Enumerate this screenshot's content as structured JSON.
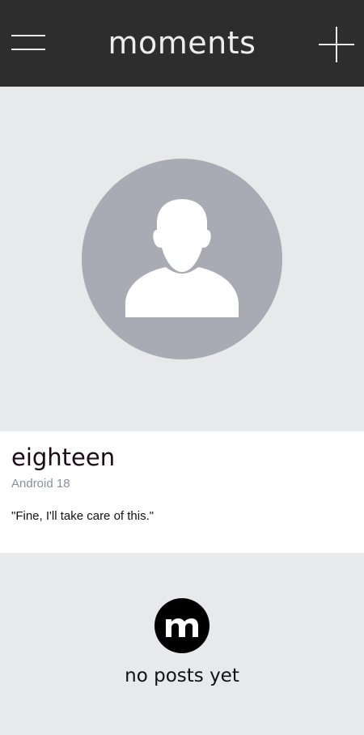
{
  "header": {
    "title": "moments",
    "menu_icon": "hamburger-menu-icon",
    "add_icon": "plus-icon",
    "background": "#2d2d2d"
  },
  "profile": {
    "avatar_icon": "default-user-avatar-icon",
    "name": "eighteen",
    "subtitle": "Android 18",
    "quote": "\"Fine, I'll take care of this.\""
  },
  "posts": {
    "logo_icon": "moments-logo-icon",
    "logo_letter": "m",
    "empty_text": "no posts yet"
  },
  "colors": {
    "header_bg": "#2d2d2d",
    "page_bg": "#e8e9eb",
    "avatar_bg": "#a8abb4",
    "card_bg": "#ffffff",
    "subtitle": "#8a8f98"
  }
}
